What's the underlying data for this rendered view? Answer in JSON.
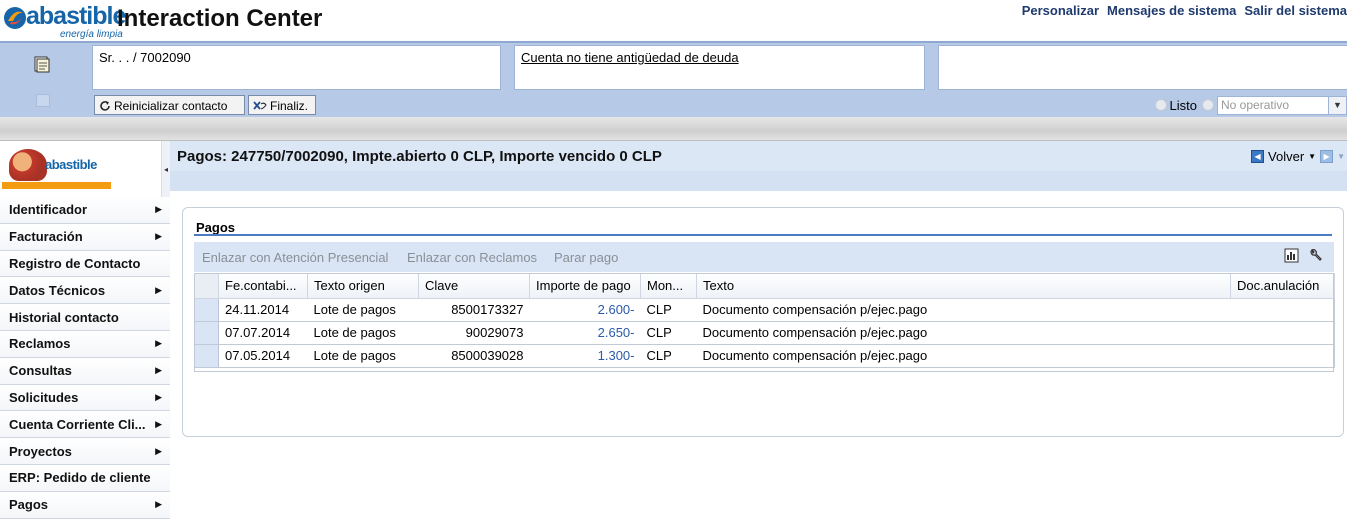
{
  "header": {
    "brand_name": "abastible",
    "brand_tagline": "energía limpia",
    "app_title": "Interaction Center",
    "links": [
      "Personalizar",
      "Mensajes de sistema",
      "Salir del sistema"
    ]
  },
  "context": {
    "customer": "Sr. . . / 7002090",
    "debt_note": "Cuenta no tiene antigüedad de deuda",
    "third_box": "",
    "buttons": {
      "reset": "Reinicializar contacto",
      "finish": "Finaliz."
    },
    "status": {
      "ready_label": "Listo",
      "select_value": "No operativo"
    }
  },
  "sidebar": {
    "logo_word": "abastible",
    "items": [
      {
        "label": "Identificador",
        "has_submenu": true
      },
      {
        "label": "Facturación",
        "has_submenu": true
      },
      {
        "label": "Registro de Contacto",
        "has_submenu": false
      },
      {
        "label": "Datos Técnicos",
        "has_submenu": true
      },
      {
        "label": "Historial contacto",
        "has_submenu": false
      },
      {
        "label": "Reclamos",
        "has_submenu": true
      },
      {
        "label": "Consultas",
        "has_submenu": true
      },
      {
        "label": "Solicitudes",
        "has_submenu": true
      },
      {
        "label": "Cuenta Corriente Cli...",
        "has_submenu": true
      },
      {
        "label": "Proyectos",
        "has_submenu": true
      },
      {
        "label": "ERP: Pedido de cliente",
        "has_submenu": false
      },
      {
        "label": "Pagos",
        "has_submenu": true
      }
    ]
  },
  "main": {
    "title": "Pagos: 247750/7002090, Impte.abierto 0 CLP, Importe vencido 0 CLP",
    "back_label": "Volver",
    "panel": {
      "title": "Pagos",
      "toolbar": [
        "Enlazar con Atención Presencial",
        "Enlazar con Reclamos",
        "Parar pago"
      ],
      "columns": [
        "Fe.contabi...",
        "Texto origen",
        "Clave",
        "Importe de pago",
        "Mon...",
        "Texto",
        "Doc.anulación"
      ],
      "rows": [
        {
          "date": "24.11.2014",
          "origin": "Lote de pagos",
          "key": "8500173327",
          "amount": "2.600-",
          "currency": "CLP",
          "text": "Documento compensación p/ejec.pago",
          "void_doc": ""
        },
        {
          "date": "07.07.2014",
          "origin": "Lote de pagos",
          "key": "90029073",
          "amount": "2.650-",
          "currency": "CLP",
          "text": "Documento compensación p/ejec.pago",
          "void_doc": ""
        },
        {
          "date": "07.05.2014",
          "origin": "Lote de pagos",
          "key": "8500039028",
          "amount": "1.300-",
          "currency": "CLP",
          "text": "Documento compensación p/ejec.pago",
          "void_doc": ""
        }
      ]
    }
  },
  "icons": [
    "brand-logo-icon",
    "notes-icon",
    "refresh-icon",
    "finish-icon",
    "collapse-left-icon",
    "back-icon",
    "forward-icon",
    "grid-settings-icon",
    "wrench-icon",
    "chevron-right-icon"
  ],
  "colors": {
    "brand_blue": "#1565a8",
    "band_blue": "#b6c9e6",
    "header_bar": "#dce7f5",
    "amount_link": "#2d5aa8"
  }
}
